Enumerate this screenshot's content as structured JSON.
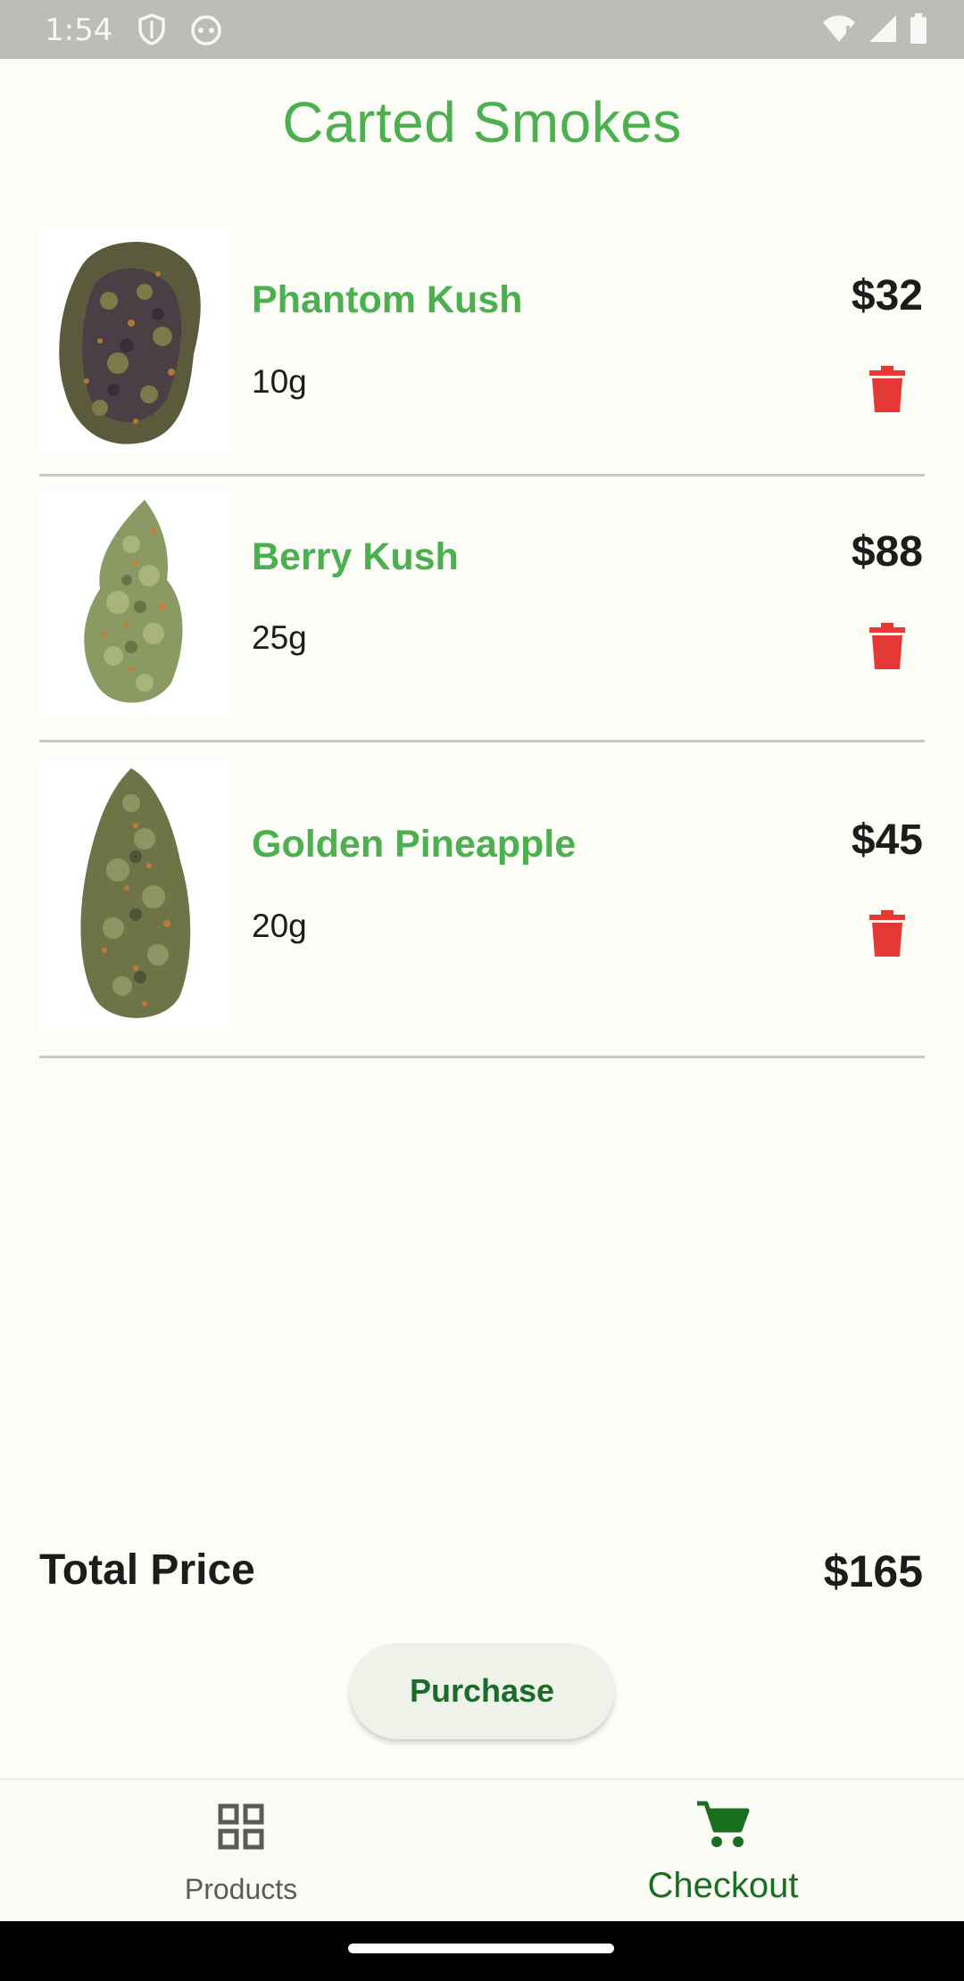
{
  "status_bar": {
    "time": "1:54"
  },
  "header": {
    "title": "Carted Smokes"
  },
  "cart": {
    "items": [
      {
        "name": "Phantom Kush",
        "quantity": "10g",
        "price": "$32",
        "image_icon": "cannabis-bud-dark-icon"
      },
      {
        "name": "Berry Kush",
        "quantity": "25g",
        "price": "$88",
        "image_icon": "cannabis-bud-light-icon"
      },
      {
        "name": "Golden Pineapple",
        "quantity": "20g",
        "price": "$45",
        "image_icon": "cannabis-bud-tall-icon"
      }
    ],
    "delete_icon": "trash-icon",
    "delete_color": "#e53935"
  },
  "summary": {
    "total_label": "Total Price",
    "total_value": "$165"
  },
  "actions": {
    "purchase_label": "Purchase"
  },
  "bottom_nav": {
    "items": [
      {
        "label": "Products",
        "icon": "grid-icon",
        "selected": false
      },
      {
        "label": "Checkout",
        "icon": "cart-icon",
        "selected": true
      }
    ]
  },
  "colors": {
    "accent": "#4caf50",
    "nav_selected": "#1a6e1f",
    "background": "#fcfdf6",
    "purchase_button_bg": "#eef2e8"
  }
}
